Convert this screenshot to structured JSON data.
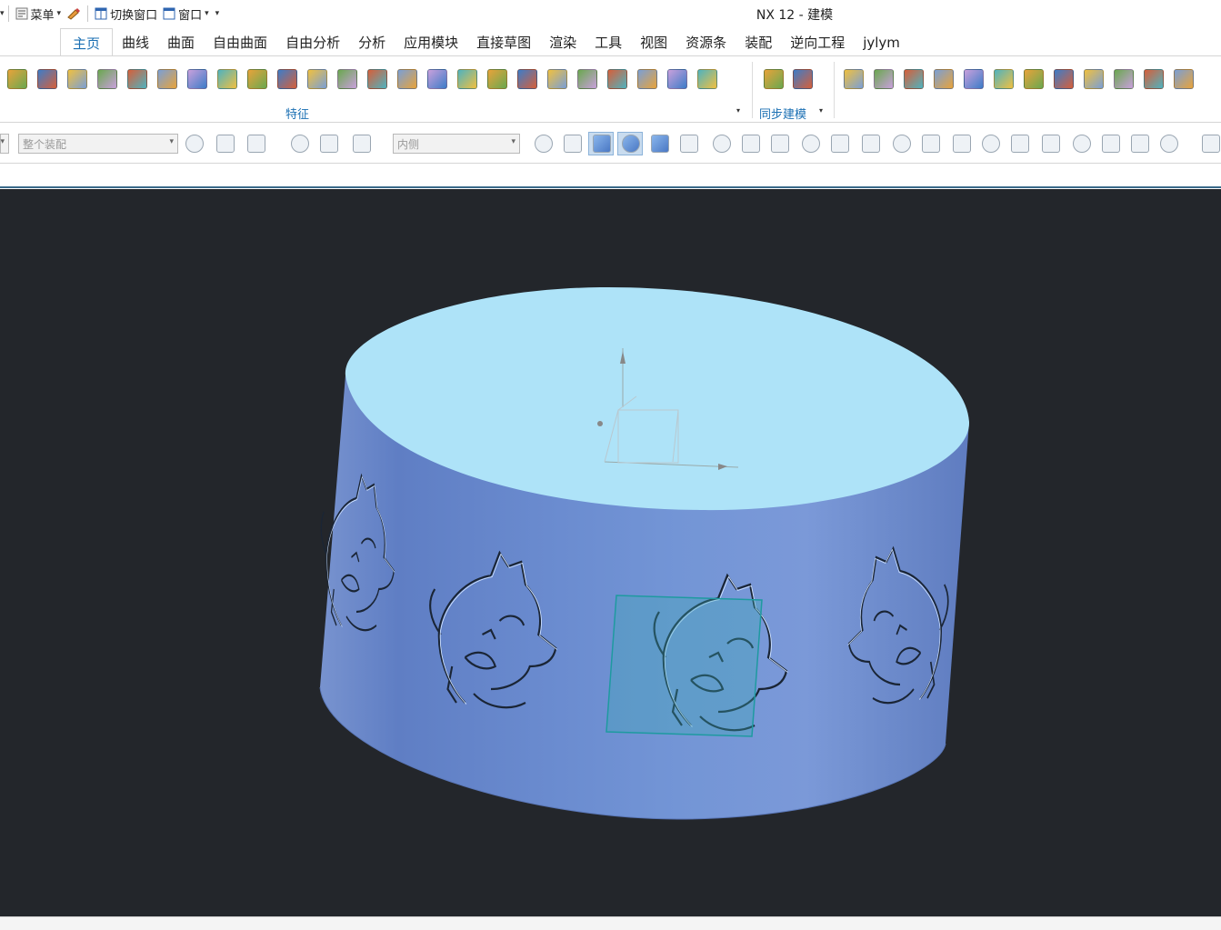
{
  "app": {
    "title": "NX 12 - 建模"
  },
  "quick_access": {
    "menu_label": "菜单",
    "switch_window_label": "切换窗口",
    "window_label": "窗口"
  },
  "tabs": [
    {
      "label": "主页",
      "active": true
    },
    {
      "label": "曲线"
    },
    {
      "label": "曲面"
    },
    {
      "label": "自由曲面"
    },
    {
      "label": "自由分析"
    },
    {
      "label": "分析"
    },
    {
      "label": "应用模块"
    },
    {
      "label": "直接草图"
    },
    {
      "label": "渲染"
    },
    {
      "label": "工具"
    },
    {
      "label": "视图"
    },
    {
      "label": "资源条"
    },
    {
      "label": "装配"
    },
    {
      "label": "逆向工程"
    },
    {
      "label": "jylym"
    }
  ],
  "ribbon": {
    "groups": [
      {
        "label": "特征"
      },
      {
        "label": "同步建模"
      }
    ]
  },
  "selection_bar": {
    "filter_value": "整个装配",
    "scope_value": "内侧"
  },
  "colors": {
    "viewport_bg": "#23262b",
    "cylinder_top": "#aee3f8",
    "cylinder_side": "#6f8fcc",
    "accent": "#1a6fb3",
    "selection_box": "#1e9aa0"
  },
  "viewport": {
    "model": "cylinder-with-embossed-wolf-heads"
  }
}
